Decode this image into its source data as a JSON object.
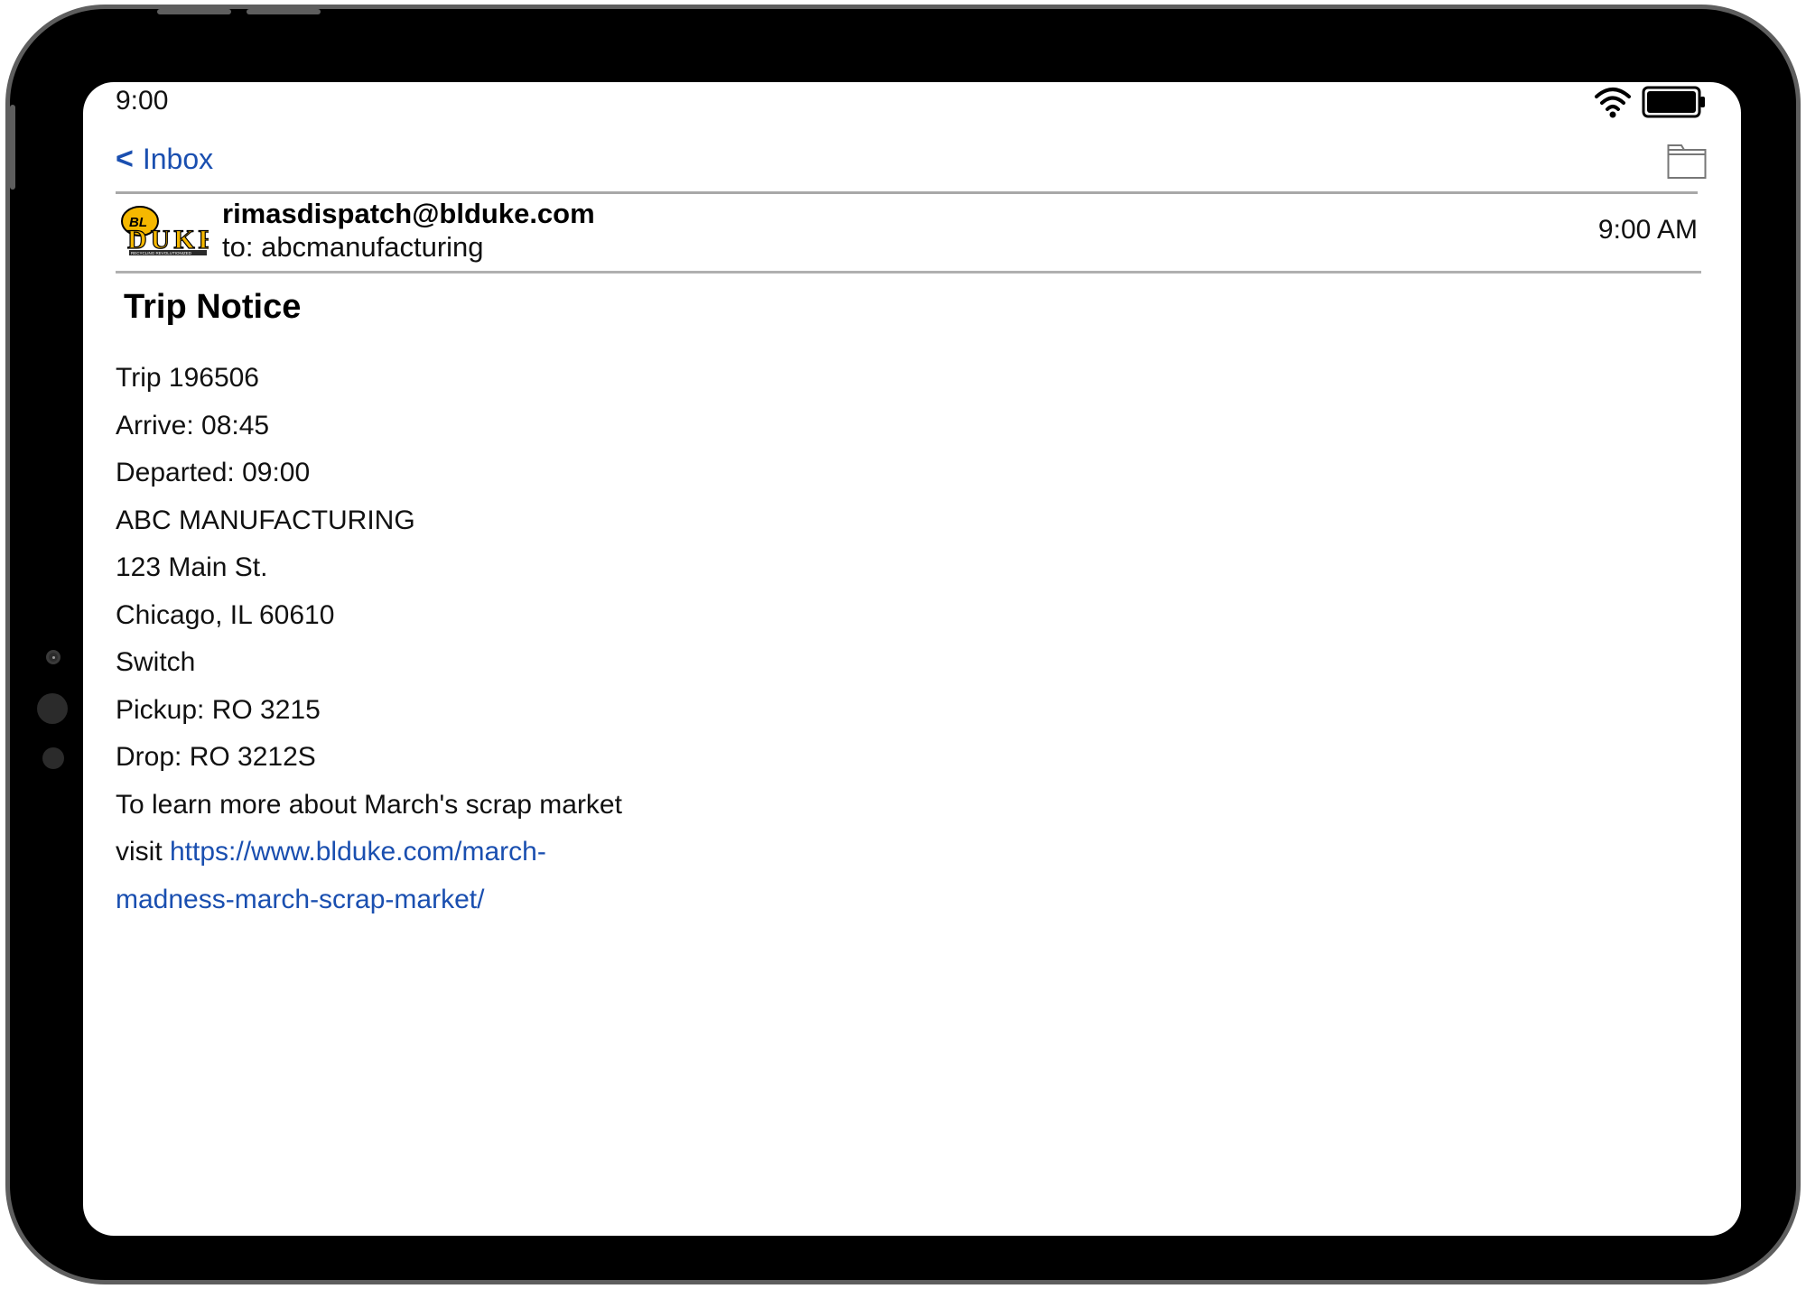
{
  "status_bar": {
    "time": "9:00",
    "icons": [
      "wifi-icon",
      "battery-icon"
    ]
  },
  "nav": {
    "back_label": "Inbox",
    "back_chevron": "<",
    "folder_icon": "folder-icon"
  },
  "message": {
    "sender": "rimasdispatch@blduke.com",
    "recipient": "to: abcmanufacturing",
    "time": "9:00 AM",
    "logo": {
      "top_text": "BL",
      "main_text": "DUKE",
      "tagline": "RECYCLING REVOLUTIONIZED"
    },
    "subject": "Trip Notice",
    "body_lines": [
      "Trip 196506",
      "Arrive: 08:45",
      "Departed: 09:00",
      "ABC MANUFACTURING",
      "123 Main St.",
      "Chicago, IL 60610",
      "Switch",
      "Pickup: RO 3215",
      "Drop: RO 3212S",
      "To learn more about March's scrap market"
    ],
    "link_prefix": "visit ",
    "link_part1": "https://www.blduke.com/march-",
    "link_part2": "madness-march-scrap-market/"
  },
  "colors": {
    "link": "#1a4fb0",
    "frame": "#000000",
    "frame_edge": "#5e5e5e",
    "divider": "#a8a8a8",
    "logo_yellow": "#f5b800"
  }
}
